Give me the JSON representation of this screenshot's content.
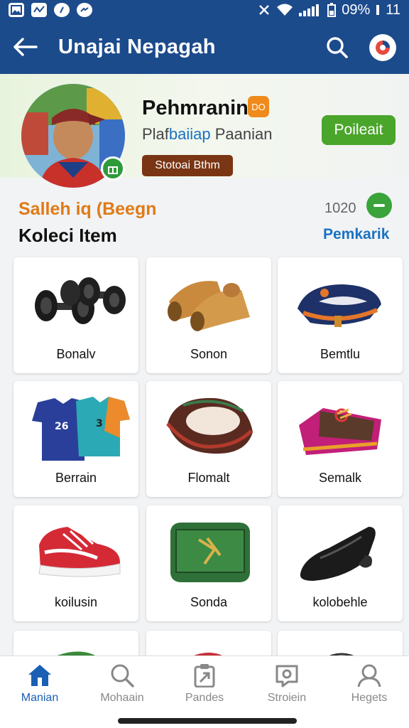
{
  "status_bar": {
    "battery_text": "09%",
    "time": "11",
    "icons": [
      "image-icon",
      "chart-icon",
      "compass-icon",
      "messenger-icon",
      "mute-icon",
      "wifi-icon",
      "signal-icon",
      "battery-icon"
    ]
  },
  "appbar": {
    "title": "Unajai Nepagah",
    "back_icon": "arrow-left-icon",
    "search_icon": "search-icon",
    "account_icon": "account-icon"
  },
  "profile": {
    "name": "Pehmranin",
    "name_badge": "DO",
    "subtitle_a": "Plaf",
    "subtitle_b": "baiiap",
    "subtitle_c": " Paanian",
    "status_badge": "Stotoai Bthm",
    "follow_label": "Poileait"
  },
  "section": {
    "tag": "Salleh iq (Beegn",
    "title": "Koleci Item",
    "count": "1020",
    "see_all": "Pemkarik"
  },
  "items": [
    {
      "label": "Bonalv",
      "icon": "dumbbell-icon"
    },
    {
      "label": "Sonon",
      "icon": "shin-guards-icon"
    },
    {
      "label": "Bemtlu",
      "icon": "belt-icon"
    },
    {
      "label": "Berrain",
      "icon": "jersey-icon"
    },
    {
      "label": "Flomalt",
      "icon": "cap-icon"
    },
    {
      "label": "Semalk",
      "icon": "bag-icon"
    },
    {
      "label": "koilusin",
      "icon": "sneaker-icon"
    },
    {
      "label": "Sonda",
      "icon": "box-icon"
    },
    {
      "label": "kolobehle",
      "icon": "whistle-icon"
    }
  ],
  "bottom_nav": [
    {
      "label": "Manian",
      "icon": "home-icon",
      "active": true
    },
    {
      "label": "Mohaain",
      "icon": "search-icon",
      "active": false
    },
    {
      "label": "Pandes",
      "icon": "clipboard-icon",
      "active": false
    },
    {
      "label": "Stroiein",
      "icon": "chat-icon",
      "active": false
    },
    {
      "label": "Hegets",
      "icon": "profile-icon",
      "active": false
    }
  ],
  "colors": {
    "appbar": "#1c4b8c",
    "accent_orange": "#e07a16",
    "link_blue": "#1a72c2",
    "follow_green": "#4aa52b"
  }
}
